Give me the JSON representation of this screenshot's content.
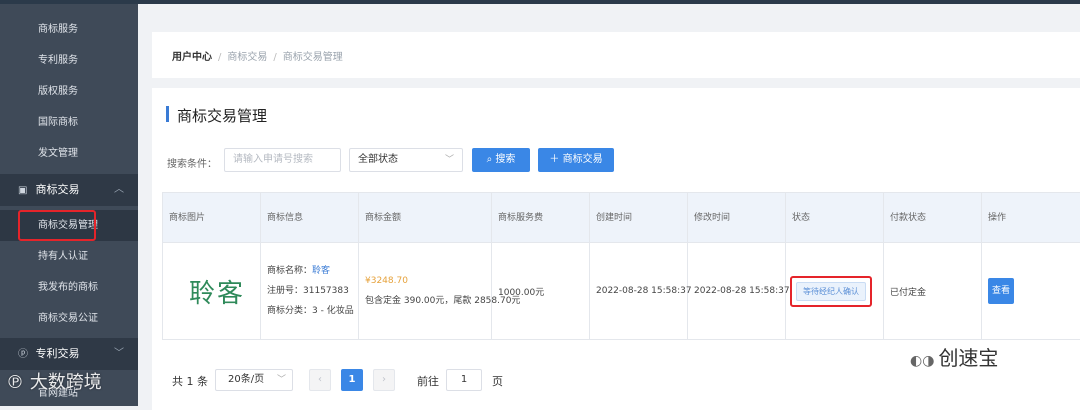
{
  "sidebar": {
    "items_top": [
      "商标服务",
      "专利服务",
      "版权服务",
      "国际商标",
      "发文管理"
    ],
    "group_trademark": {
      "label": "商标交易",
      "icon": "trademark-icon"
    },
    "trademark_items": [
      "商标交易管理",
      "持有人认证",
      "我发布的商标",
      "商标交易公证"
    ],
    "group_patent": {
      "label": "专利交易",
      "icon": "patent-icon"
    },
    "bottom_item": "官网建站"
  },
  "breadcrumb": [
    "用户中心",
    "商标交易",
    "商标交易管理"
  ],
  "page_title": "商标交易管理",
  "search": {
    "label": "搜索条件：",
    "placeholder": "请输入申请号搜索",
    "status_value": "全部状态",
    "search_button": "搜索",
    "add_button": "商标交易"
  },
  "table": {
    "headers": [
      "商标图片",
      "商标信息",
      "商标金额",
      "商标服务费",
      "创建时间",
      "修改时间",
      "状态",
      "付款状态",
      "操作"
    ],
    "row": {
      "image_text": "聆客",
      "name_label": "商标名称：",
      "name_value": "聆客",
      "reg_label": "注册号：",
      "reg_value": "31157383",
      "class_label": "商标分类：",
      "class_value": "3 - 化妆品",
      "amount": "¥3248.70",
      "amount_detail": "包含定金 390.00元，尾款 2858.70元",
      "service_fee": "1000.00元",
      "created": "2022-08-28 15:58:37",
      "modified": "2022-08-28 15:58:37",
      "status": "等待经纪人确认",
      "pay_status": "已付定金",
      "action": "查看"
    }
  },
  "pager": {
    "total": "共 1 条",
    "page_size": "20条/页",
    "current": "1",
    "goto_label": "前往",
    "goto_value": "1",
    "page_label": "页"
  },
  "watermark": {
    "left": "大数跨境",
    "right": "创速宝"
  },
  "colors": {
    "accent": "#3a87e6",
    "highlight": "#e5242a",
    "sidebar": "#3f4a58"
  }
}
